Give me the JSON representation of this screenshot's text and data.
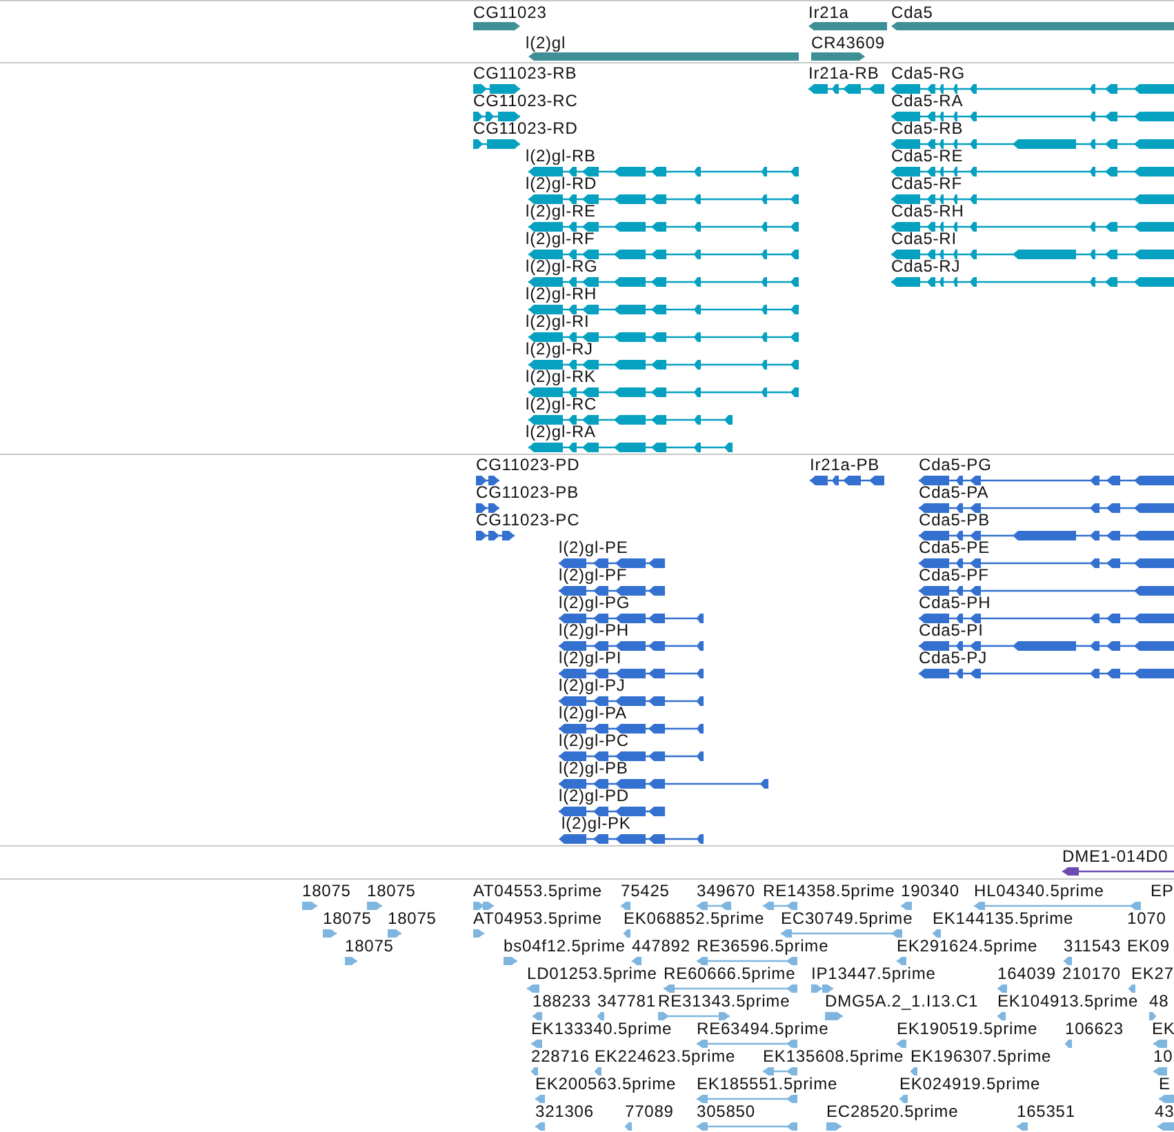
{
  "tracks": [
    {
      "kind": "gene",
      "features": [
        {
          "label": "CG11023",
          "reverse": false
        },
        {
          "label": "l(2)gl",
          "reverse": true
        },
        {
          "label": "Ir21a",
          "reverse": true
        },
        {
          "label": "CR43609",
          "reverse": false
        },
        {
          "label": "Cda5",
          "reverse": true
        }
      ]
    },
    {
      "kind": "transcript",
      "features": [
        {
          "label": "CG11023-RB",
          "reverse": false
        },
        {
          "label": "CG11023-RC",
          "reverse": false
        },
        {
          "label": "CG11023-RD",
          "reverse": false
        },
        {
          "label": "l(2)gl-RB",
          "reverse": true
        },
        {
          "label": "l(2)gl-RD",
          "reverse": true
        },
        {
          "label": "l(2)gl-RE",
          "reverse": true
        },
        {
          "label": "l(2)gl-RF",
          "reverse": true
        },
        {
          "label": "l(2)gl-RG",
          "reverse": true
        },
        {
          "label": "l(2)gl-RH",
          "reverse": true
        },
        {
          "label": "l(2)gl-RI",
          "reverse": true
        },
        {
          "label": "l(2)gl-RJ",
          "reverse": true
        },
        {
          "label": "l(2)gl-RK",
          "reverse": true
        },
        {
          "label": "l(2)gl-RC",
          "reverse": true
        },
        {
          "label": "l(2)gl-RA",
          "reverse": true
        },
        {
          "label": "Ir21a-RB",
          "reverse": true
        },
        {
          "label": "Cda5-RG",
          "reverse": true
        },
        {
          "label": "Cda5-RA",
          "reverse": true
        },
        {
          "label": "Cda5-RB",
          "reverse": true
        },
        {
          "label": "Cda5-RE",
          "reverse": true
        },
        {
          "label": "Cda5-RF",
          "reverse": true
        },
        {
          "label": "Cda5-RH",
          "reverse": true
        },
        {
          "label": "Cda5-RI",
          "reverse": true
        },
        {
          "label": "Cda5-RJ",
          "reverse": true
        }
      ]
    },
    {
      "kind": "protein",
      "features": [
        {
          "label": "CG11023-PD",
          "reverse": false
        },
        {
          "label": "CG11023-PB",
          "reverse": false
        },
        {
          "label": "CG11023-PC",
          "reverse": false
        },
        {
          "label": "l(2)gl-PE",
          "reverse": true
        },
        {
          "label": "l(2)gl-PF",
          "reverse": true
        },
        {
          "label": "l(2)gl-PG",
          "reverse": true
        },
        {
          "label": "l(2)gl-PH",
          "reverse": true
        },
        {
          "label": "l(2)gl-PI",
          "reverse": true
        },
        {
          "label": "l(2)gl-PJ",
          "reverse": true
        },
        {
          "label": "l(2)gl-PA",
          "reverse": true
        },
        {
          "label": "l(2)gl-PC",
          "reverse": true
        },
        {
          "label": "l(2)gl-PB",
          "reverse": true
        },
        {
          "label": "l(2)gl-PD",
          "reverse": true
        },
        {
          "label": "l(2)gl-PK",
          "reverse": true
        },
        {
          "label": "Ir21a-PB",
          "reverse": true
        },
        {
          "label": "Cda5-PG",
          "reverse": true
        },
        {
          "label": "Cda5-PA",
          "reverse": true
        },
        {
          "label": "Cda5-PB",
          "reverse": true
        },
        {
          "label": "Cda5-PE",
          "reverse": true
        },
        {
          "label": "Cda5-PF",
          "reverse": true
        },
        {
          "label": "Cda5-PH",
          "reverse": true
        },
        {
          "label": "Cda5-PI",
          "reverse": true
        },
        {
          "label": "Cda5-PJ",
          "reverse": true
        }
      ]
    },
    {
      "kind": "variant",
      "features": [
        {
          "label": "DME1-014D0",
          "reverse": true
        }
      ]
    },
    {
      "kind": "est",
      "features": [
        {
          "label": "18075",
          "reverse": false
        },
        {
          "label": "18075",
          "reverse": false
        },
        {
          "label": "AT04553.5prime",
          "reverse": false
        },
        {
          "label": "75425",
          "reverse": true
        },
        {
          "label": "349670",
          "reverse": true
        },
        {
          "label": "RE14358.5prime",
          "reverse": true
        },
        {
          "label": "190340",
          "reverse": true
        },
        {
          "label": "HL04340.5prime",
          "reverse": true
        },
        {
          "label": "EP"
        },
        {
          "label": "18075",
          "reverse": false
        },
        {
          "label": "18075",
          "reverse": false
        },
        {
          "label": "AT04953.5prime",
          "reverse": false
        },
        {
          "label": "EK068852.5prime",
          "reverse": true
        },
        {
          "label": "EC30749.5prime",
          "reverse": true
        },
        {
          "label": "EK144135.5prime",
          "reverse": true
        },
        {
          "label": "1070"
        },
        {
          "label": "18075",
          "reverse": false
        },
        {
          "label": "bs04f12.5prime",
          "reverse": false
        },
        {
          "label": "447892",
          "reverse": true
        },
        {
          "label": "RE36596.5prime",
          "reverse": true
        },
        {
          "label": "EK291624.5prime",
          "reverse": true
        },
        {
          "label": "311543",
          "reverse": true
        },
        {
          "label": "EK09"
        },
        {
          "label": "LD01253.5prime",
          "reverse": true
        },
        {
          "label": "RE60666.5prime",
          "reverse": true
        },
        {
          "label": "IP13447.5prime",
          "reverse": false
        },
        {
          "label": "164039",
          "reverse": true
        },
        {
          "label": "210170",
          "reverse": true
        },
        {
          "label": "EK27"
        },
        {
          "label": "188233",
          "reverse": true
        },
        {
          "label": "347781",
          "reverse": true
        },
        {
          "label": "RE31343.5prime",
          "reverse": false
        },
        {
          "label": "DMG5A.2_1.I13.C1",
          "reverse": false
        },
        {
          "label": "EK104913.5prime",
          "reverse": true
        },
        {
          "label": "48",
          "reverse": false
        },
        {
          "label": "EK133340.5prime",
          "reverse": true
        },
        {
          "label": "RE63494.5prime",
          "reverse": true
        },
        {
          "label": "EK190519.5prime",
          "reverse": true
        },
        {
          "label": "106623",
          "reverse": true
        },
        {
          "label": "EK",
          "reverse": true
        },
        {
          "label": "228716",
          "reverse": true
        },
        {
          "label": "EK224623.5prime",
          "reverse": true
        },
        {
          "label": "EK135608.5prime",
          "reverse": true
        },
        {
          "label": "EK196307.5prime",
          "reverse": true
        },
        {
          "label": "10",
          "reverse": true
        },
        {
          "label": "EK200563.5prime",
          "reverse": true
        },
        {
          "label": "EK185551.5prime",
          "reverse": true
        },
        {
          "label": "EK024919.5prime",
          "reverse": true
        },
        {
          "label": "E",
          "reverse": true
        },
        {
          "label": "321306",
          "reverse": true
        },
        {
          "label": "77089",
          "reverse": true
        },
        {
          "label": "305850",
          "reverse": true
        },
        {
          "label": "EC28520.5prime",
          "reverse": false
        },
        {
          "label": "165351",
          "reverse": true
        },
        {
          "label": "43",
          "reverse": true
        }
      ]
    }
  ]
}
